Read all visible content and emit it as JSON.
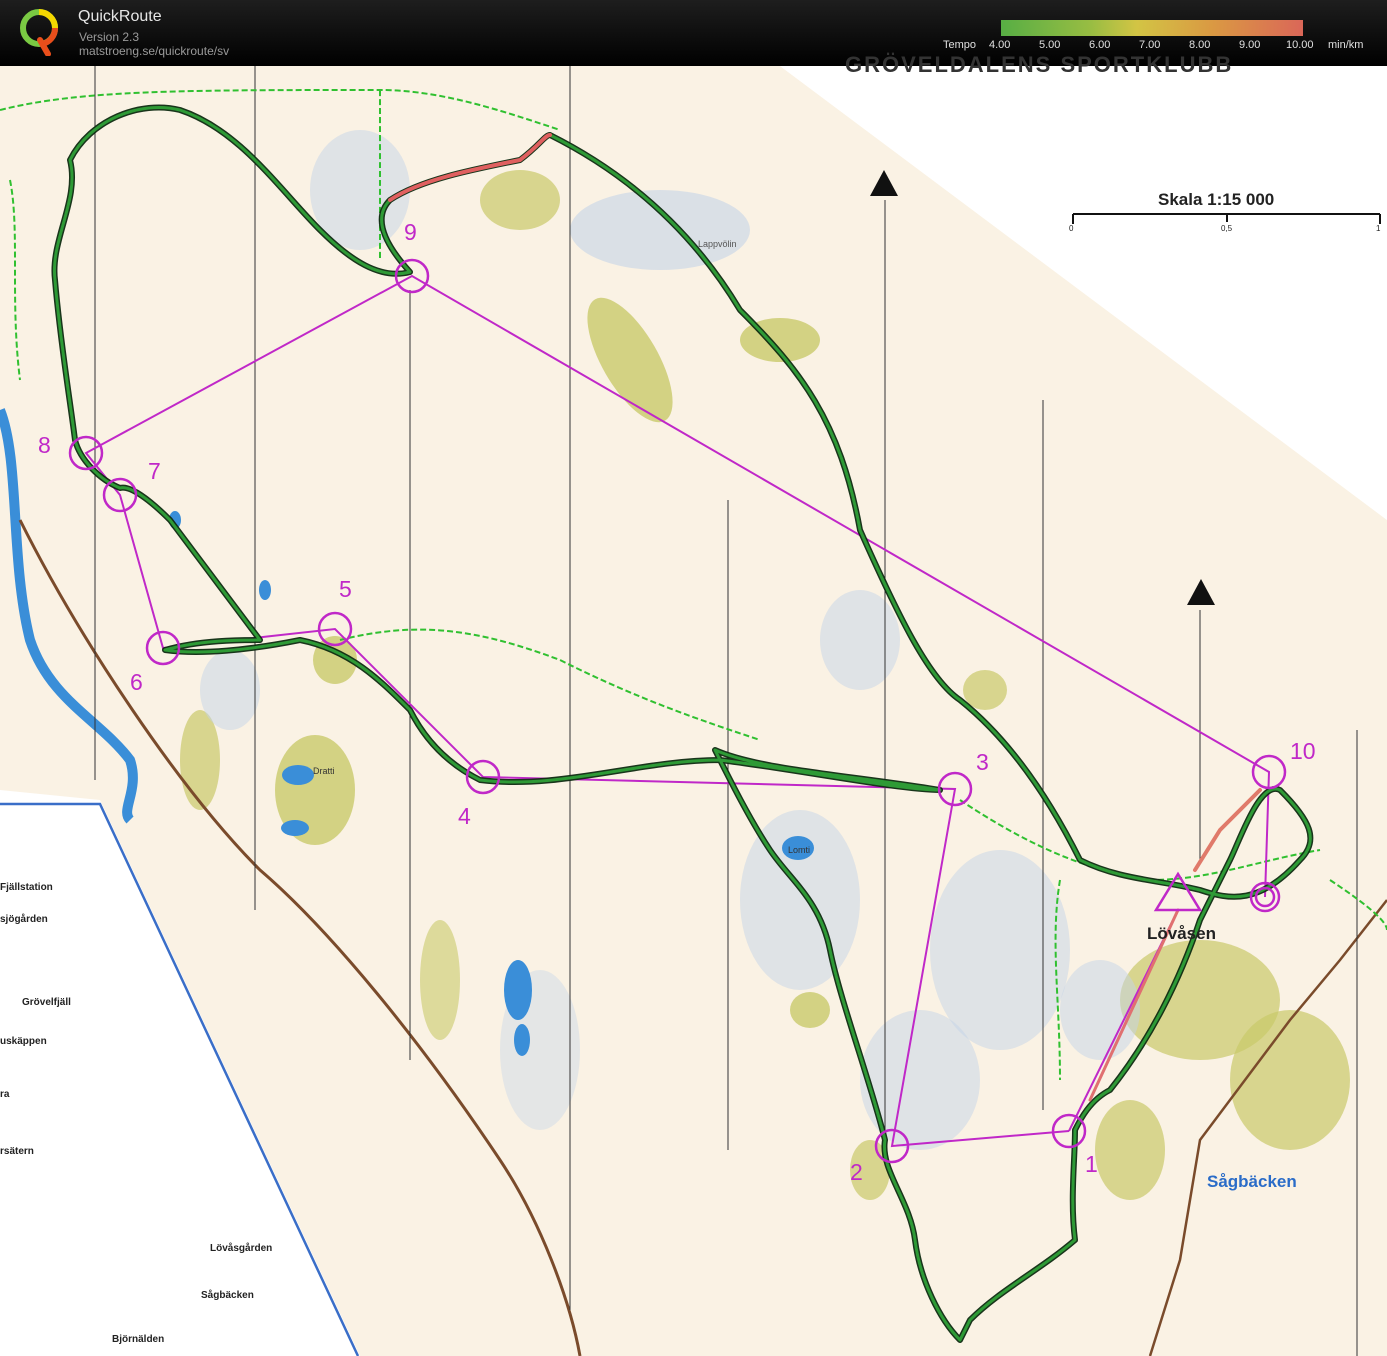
{
  "app": {
    "name": "QuickRoute",
    "version": "Version 2.3",
    "url": "matstroeng.se/quickroute/sv"
  },
  "legend": {
    "label": "Tempo",
    "ticks": [
      "4.00",
      "5.00",
      "6.00",
      "7.00",
      "8.00",
      "9.00",
      "10.00"
    ],
    "unit": "min/km",
    "colors": [
      "#5fbf4a",
      "#e8d84a",
      "#f07060"
    ]
  },
  "map": {
    "header_text": "GRÖVELDALENS SPORTKLUBB",
    "scale_label": "Skala 1:15 000",
    "scale_ticks": [
      "0",
      "0,5",
      "1"
    ],
    "course_color": "#c028c8",
    "route_color": "#1f6b25",
    "controls": [
      {
        "label": "1"
      },
      {
        "label": "2"
      },
      {
        "label": "3"
      },
      {
        "label": "4"
      },
      {
        "label": "5"
      },
      {
        "label": "6"
      },
      {
        "label": "7"
      },
      {
        "label": "8"
      },
      {
        "label": "9"
      },
      {
        "label": "10"
      }
    ],
    "place_names": {
      "lovasen": "Lövåsen",
      "sagbacken_town": "Sågbäcken",
      "lappvolin": "Lappvölin",
      "lomti": "Lomti",
      "dratti": "Dratti",
      "fjallstation": "Fjällstation",
      "sjogarden": "sjögården",
      "grovelfjall": "Grövelfjäll",
      "uskappen": "uskäppen",
      "ra": "ra",
      "rsatern": "rsätern",
      "lovasgarden": "Lövåsgården",
      "sagbacken": "Sågbäcken",
      "bjornalden": "Björnälden"
    }
  }
}
